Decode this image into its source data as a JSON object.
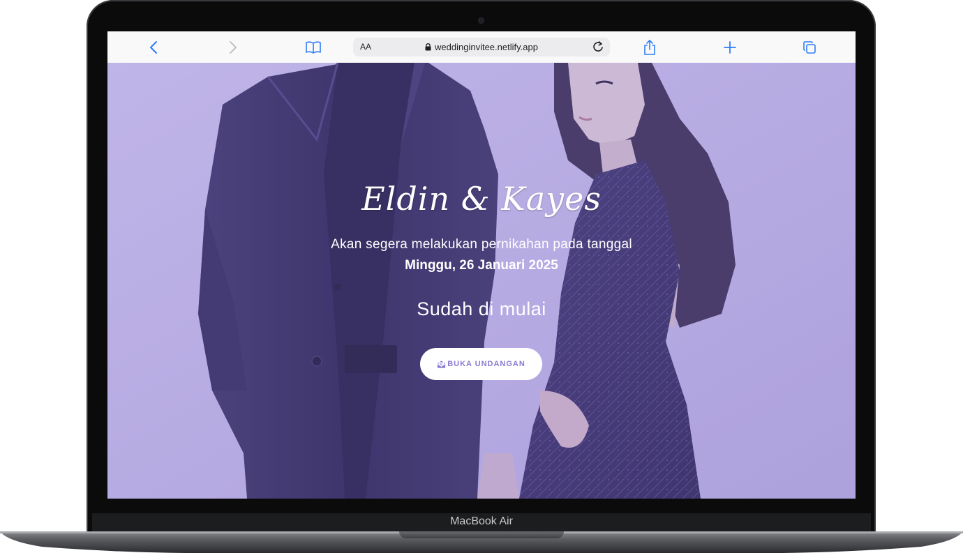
{
  "browser": {
    "text_size_label": "AA",
    "url": "weddinginvitee.netlify.app"
  },
  "device": {
    "model_label": "MacBook Air"
  },
  "hero": {
    "couple_names": "Eldin & Kayes",
    "announcement": "Akan segera melakukan pernikahan pada tanggal",
    "date": "Minggu, 26 Januari 2025",
    "status": "Sudah di mulai",
    "open_button_label": "BUKA UNDANGAN"
  },
  "colors": {
    "overlay": "#bcb3e4",
    "accent": "#8a78d3",
    "browser_blue": "#2f7cf6"
  },
  "icons": {
    "back": "chevron-left-icon",
    "forward": "chevron-right-icon",
    "bookmarks": "book-icon",
    "lock": "lock-icon",
    "reload": "reload-icon",
    "share": "share-icon",
    "new_tab": "plus-icon",
    "tabs": "tabs-icon",
    "button": "envelope-open-icon"
  }
}
